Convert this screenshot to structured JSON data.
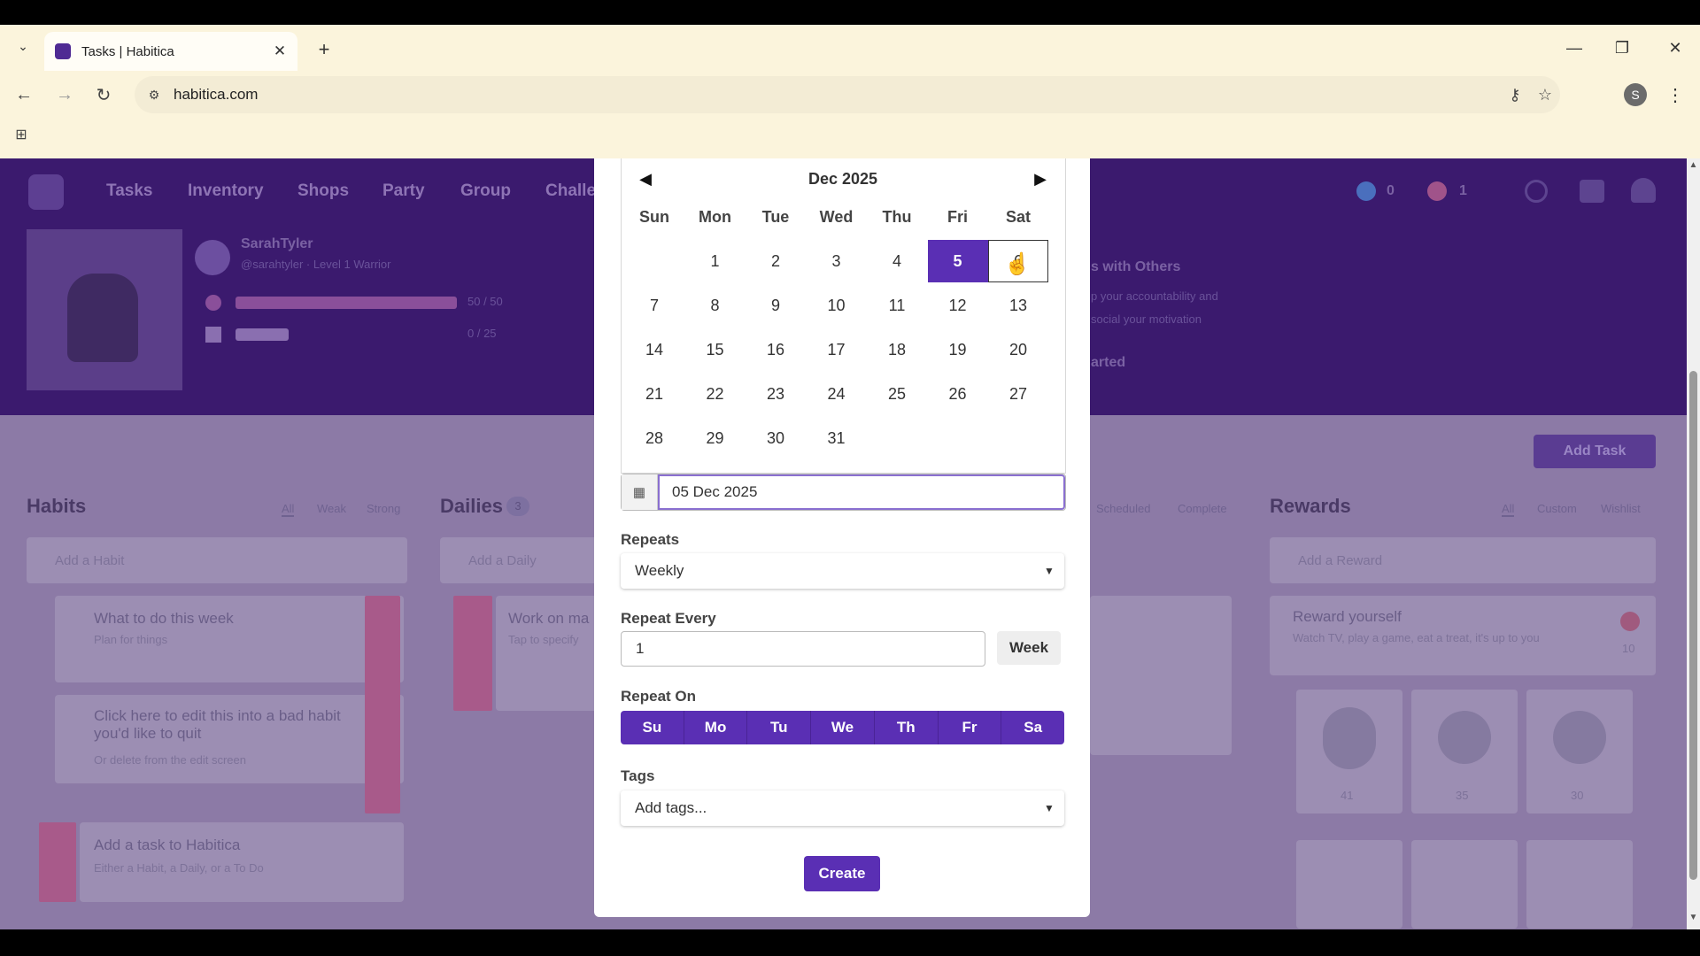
{
  "browser": {
    "tab_title": "Tasks | Habitica",
    "url": "habitica.com",
    "profile_initial": "S",
    "icons": {
      "tab_dropdown": "chevron-down-icon",
      "tab_close": "close-icon",
      "new_tab": "plus-icon",
      "minimize": "minimize-icon",
      "restore": "restore-icon",
      "close_window": "close-icon",
      "back": "arrow-left-icon",
      "forward": "arrow-right-icon",
      "reload": "reload-icon",
      "site_info": "tune-icon",
      "password": "key-icon",
      "bookmark": "star-icon",
      "menu": "kebab-icon",
      "apps": "grid-icon"
    }
  },
  "page": {
    "nav": [
      "Tasks",
      "Inventory",
      "Shops",
      "Party",
      "Group",
      "Challe"
    ],
    "user_name": "SarahTyler",
    "user_sub": "@sarahtyler · Level 1 Warrior",
    "hp_text": "50 / 50",
    "exp_text": "0 / 25",
    "header_promo": "s with Others",
    "header_promo_line1": "p your accountability and",
    "header_promo_line2": "social your motivation",
    "header_promo_cta": "arted",
    "currency_gems": "0",
    "currency_gold": "1",
    "add_task": "Add Task",
    "columns": {
      "habits": "Habits",
      "dailies": "Dailies",
      "dailies_count": "3",
      "rewards": "Rewards"
    },
    "habits_filters": [
      "All",
      "Weak",
      "Strong"
    ],
    "dailies_filters": [
      "Scheduled",
      "Complete"
    ],
    "rewards_filters": [
      "All",
      "Custom",
      "Wishlist"
    ],
    "habits_add": "Add a Habit",
    "dailies_add": "Add a Daily",
    "rewards_add": "Add a Reward",
    "habit_cards": [
      {
        "title": "What to do this week",
        "sub": "Plan for things"
      },
      {
        "title": "Click here to edit this into a bad habit you'd like to quit",
        "sub": "Or delete from the edit screen"
      },
      {
        "title": "Add a task to Habitica",
        "sub": "Either a Habit, a Daily, or a To Do"
      }
    ],
    "daily_card": {
      "title": "Work on ma",
      "sub": "Tap to specify"
    },
    "reward_card": {
      "title": "Reward yourself",
      "sub": "Watch TV, play a game, eat a treat, it's up to you",
      "cost": "10"
    },
    "reward_item_costs": [
      "41",
      "35",
      "30"
    ]
  },
  "modal": {
    "calendar": {
      "month_label": "Dec 2025",
      "prev_icon": "triangle-left-icon",
      "next_icon": "triangle-right-icon",
      "weekdays": [
        "Sun",
        "Mon",
        "Tue",
        "Wed",
        "Thu",
        "Fri",
        "Sat"
      ],
      "weeks": [
        [
          "",
          "1",
          "2",
          "3",
          "4",
          "5",
          "6"
        ],
        [
          "7",
          "8",
          "9",
          "10",
          "11",
          "12",
          "13"
        ],
        [
          "14",
          "15",
          "16",
          "17",
          "18",
          "19",
          "20"
        ],
        [
          "21",
          "22",
          "23",
          "24",
          "25",
          "26",
          "27"
        ],
        [
          "28",
          "29",
          "30",
          "31",
          "",
          "",
          ""
        ]
      ],
      "selected_day": "5",
      "hovered_day": "6"
    },
    "date_value": "05 Dec 2025",
    "repeats_label": "Repeats",
    "repeats_value": "Weekly",
    "repeat_every_label": "Repeat Every",
    "repeat_every_value": "1",
    "repeat_unit": "Week",
    "repeat_on_label": "Repeat On",
    "repeat_days": [
      "Su",
      "Mo",
      "Tu",
      "We",
      "Th",
      "Fr",
      "Sa"
    ],
    "tags_label": "Tags",
    "tags_placeholder": "Add tags...",
    "create_label": "Create",
    "accent_color": "#5a2fb4"
  }
}
